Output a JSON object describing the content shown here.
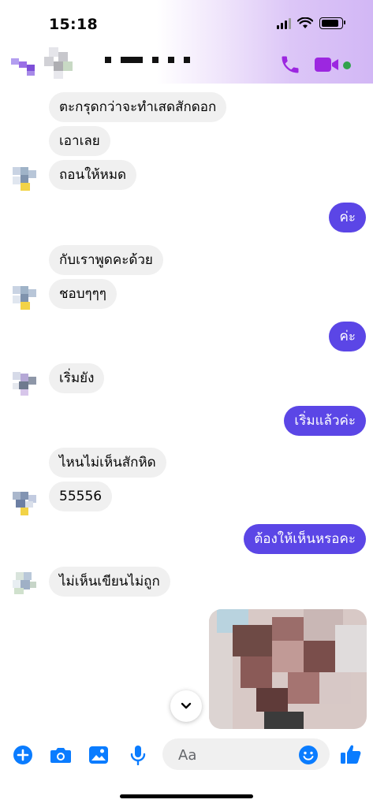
{
  "status": {
    "time": "15:18"
  },
  "header": {
    "name_redacted": true,
    "accent_color": "#9c27e0"
  },
  "messages": [
    {
      "side": "in",
      "text": "ตะกรุดกว่าจะทำเสดสักดอก"
    },
    {
      "side": "in",
      "text": "เอาเลย"
    },
    {
      "side": "in",
      "text": "ถอนให้หมด"
    },
    {
      "side": "out",
      "text": "ค่ะ"
    },
    {
      "side": "in",
      "text": "กับเราพูดคะด้วย"
    },
    {
      "side": "in",
      "text": "ชอบๆๆๆ"
    },
    {
      "side": "out",
      "text": "ค่ะ"
    },
    {
      "side": "in",
      "text": "เริ่มยัง"
    },
    {
      "side": "out",
      "text": "เริ่มแล้วค่ะ"
    },
    {
      "side": "in",
      "text": "ไหนไม่เห็นสักหิด"
    },
    {
      "side": "in",
      "text": "55556"
    },
    {
      "side": "out",
      "text": "ต้องให้เห็นหรอคะ"
    },
    {
      "side": "in",
      "text": "ไม่เห็นเขียนไม่ถูก"
    }
  ],
  "composer": {
    "placeholder": "Aa"
  },
  "colors": {
    "outgoing_bubble": "#5b46e6",
    "incoming_bubble": "#f0f0f0",
    "icon_blue": "#0a7cff",
    "icon_purple": "#9c27e0"
  }
}
